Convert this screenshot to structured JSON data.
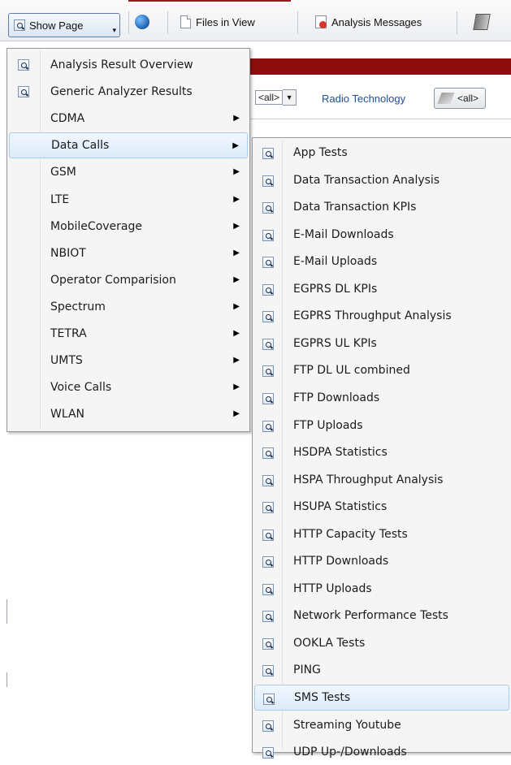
{
  "toolbar": {
    "show_page": "Show Page",
    "files_in_view": "Files in View",
    "analysis_messages": "Analysis Messages"
  },
  "filters": {
    "first_select": "<all>",
    "radio_label": "Radio Technology",
    "radio_value": "<all>"
  },
  "menu": {
    "items": [
      {
        "label": "Analysis Result Overview",
        "icon": "magnifier-page-icon",
        "submenu": false
      },
      {
        "label": "Generic Analyzer Results",
        "icon": "magnifier-page-icon",
        "submenu": false
      },
      {
        "label": "CDMA",
        "submenu": true
      },
      {
        "label": "Data Calls",
        "submenu": true,
        "highlighted": true
      },
      {
        "label": "GSM",
        "submenu": true
      },
      {
        "label": "LTE",
        "submenu": true
      },
      {
        "label": "MobileCoverage",
        "submenu": true
      },
      {
        "label": "NBIOT",
        "submenu": true
      },
      {
        "label": "Operator Comparision",
        "submenu": true
      },
      {
        "label": "Spectrum",
        "submenu": true
      },
      {
        "label": "TETRA",
        "submenu": true
      },
      {
        "label": "UMTS",
        "submenu": true
      },
      {
        "label": "Voice Calls",
        "submenu": true
      },
      {
        "label": "WLAN",
        "submenu": true
      }
    ]
  },
  "submenu": {
    "items": [
      {
        "label": "App Tests"
      },
      {
        "label": "Data Transaction Analysis"
      },
      {
        "label": "Data Transaction KPIs"
      },
      {
        "label": "E-Mail Downloads"
      },
      {
        "label": "E-Mail Uploads"
      },
      {
        "label": "EGPRS DL KPIs"
      },
      {
        "label": "EGPRS Throughput Analysis"
      },
      {
        "label": "EGPRS UL KPIs"
      },
      {
        "label": "FTP DL UL combined"
      },
      {
        "label": "FTP Downloads"
      },
      {
        "label": "FTP Uploads"
      },
      {
        "label": "HSDPA Statistics"
      },
      {
        "label": "HSPA Throughput Analysis"
      },
      {
        "label": "HSUPA Statistics"
      },
      {
        "label": "HTTP Capacity Tests"
      },
      {
        "label": "HTTP Downloads"
      },
      {
        "label": "HTTP Uploads"
      },
      {
        "label": "Network Performance Tests"
      },
      {
        "label": "OOKLA Tests"
      },
      {
        "label": "PING"
      },
      {
        "label": "SMS Tests",
        "highlighted": true
      },
      {
        "label": "Streaming Youtube"
      },
      {
        "label": "UDP Up-/Downloads"
      }
    ]
  },
  "icons": {
    "menu_item": "magnifier-page-icon",
    "submenu_arrow": "▶"
  },
  "colors": {
    "highlight_border": "#a7cdf0",
    "header_bar": "#8c0e0e",
    "link_text": "#1e4f9a"
  }
}
